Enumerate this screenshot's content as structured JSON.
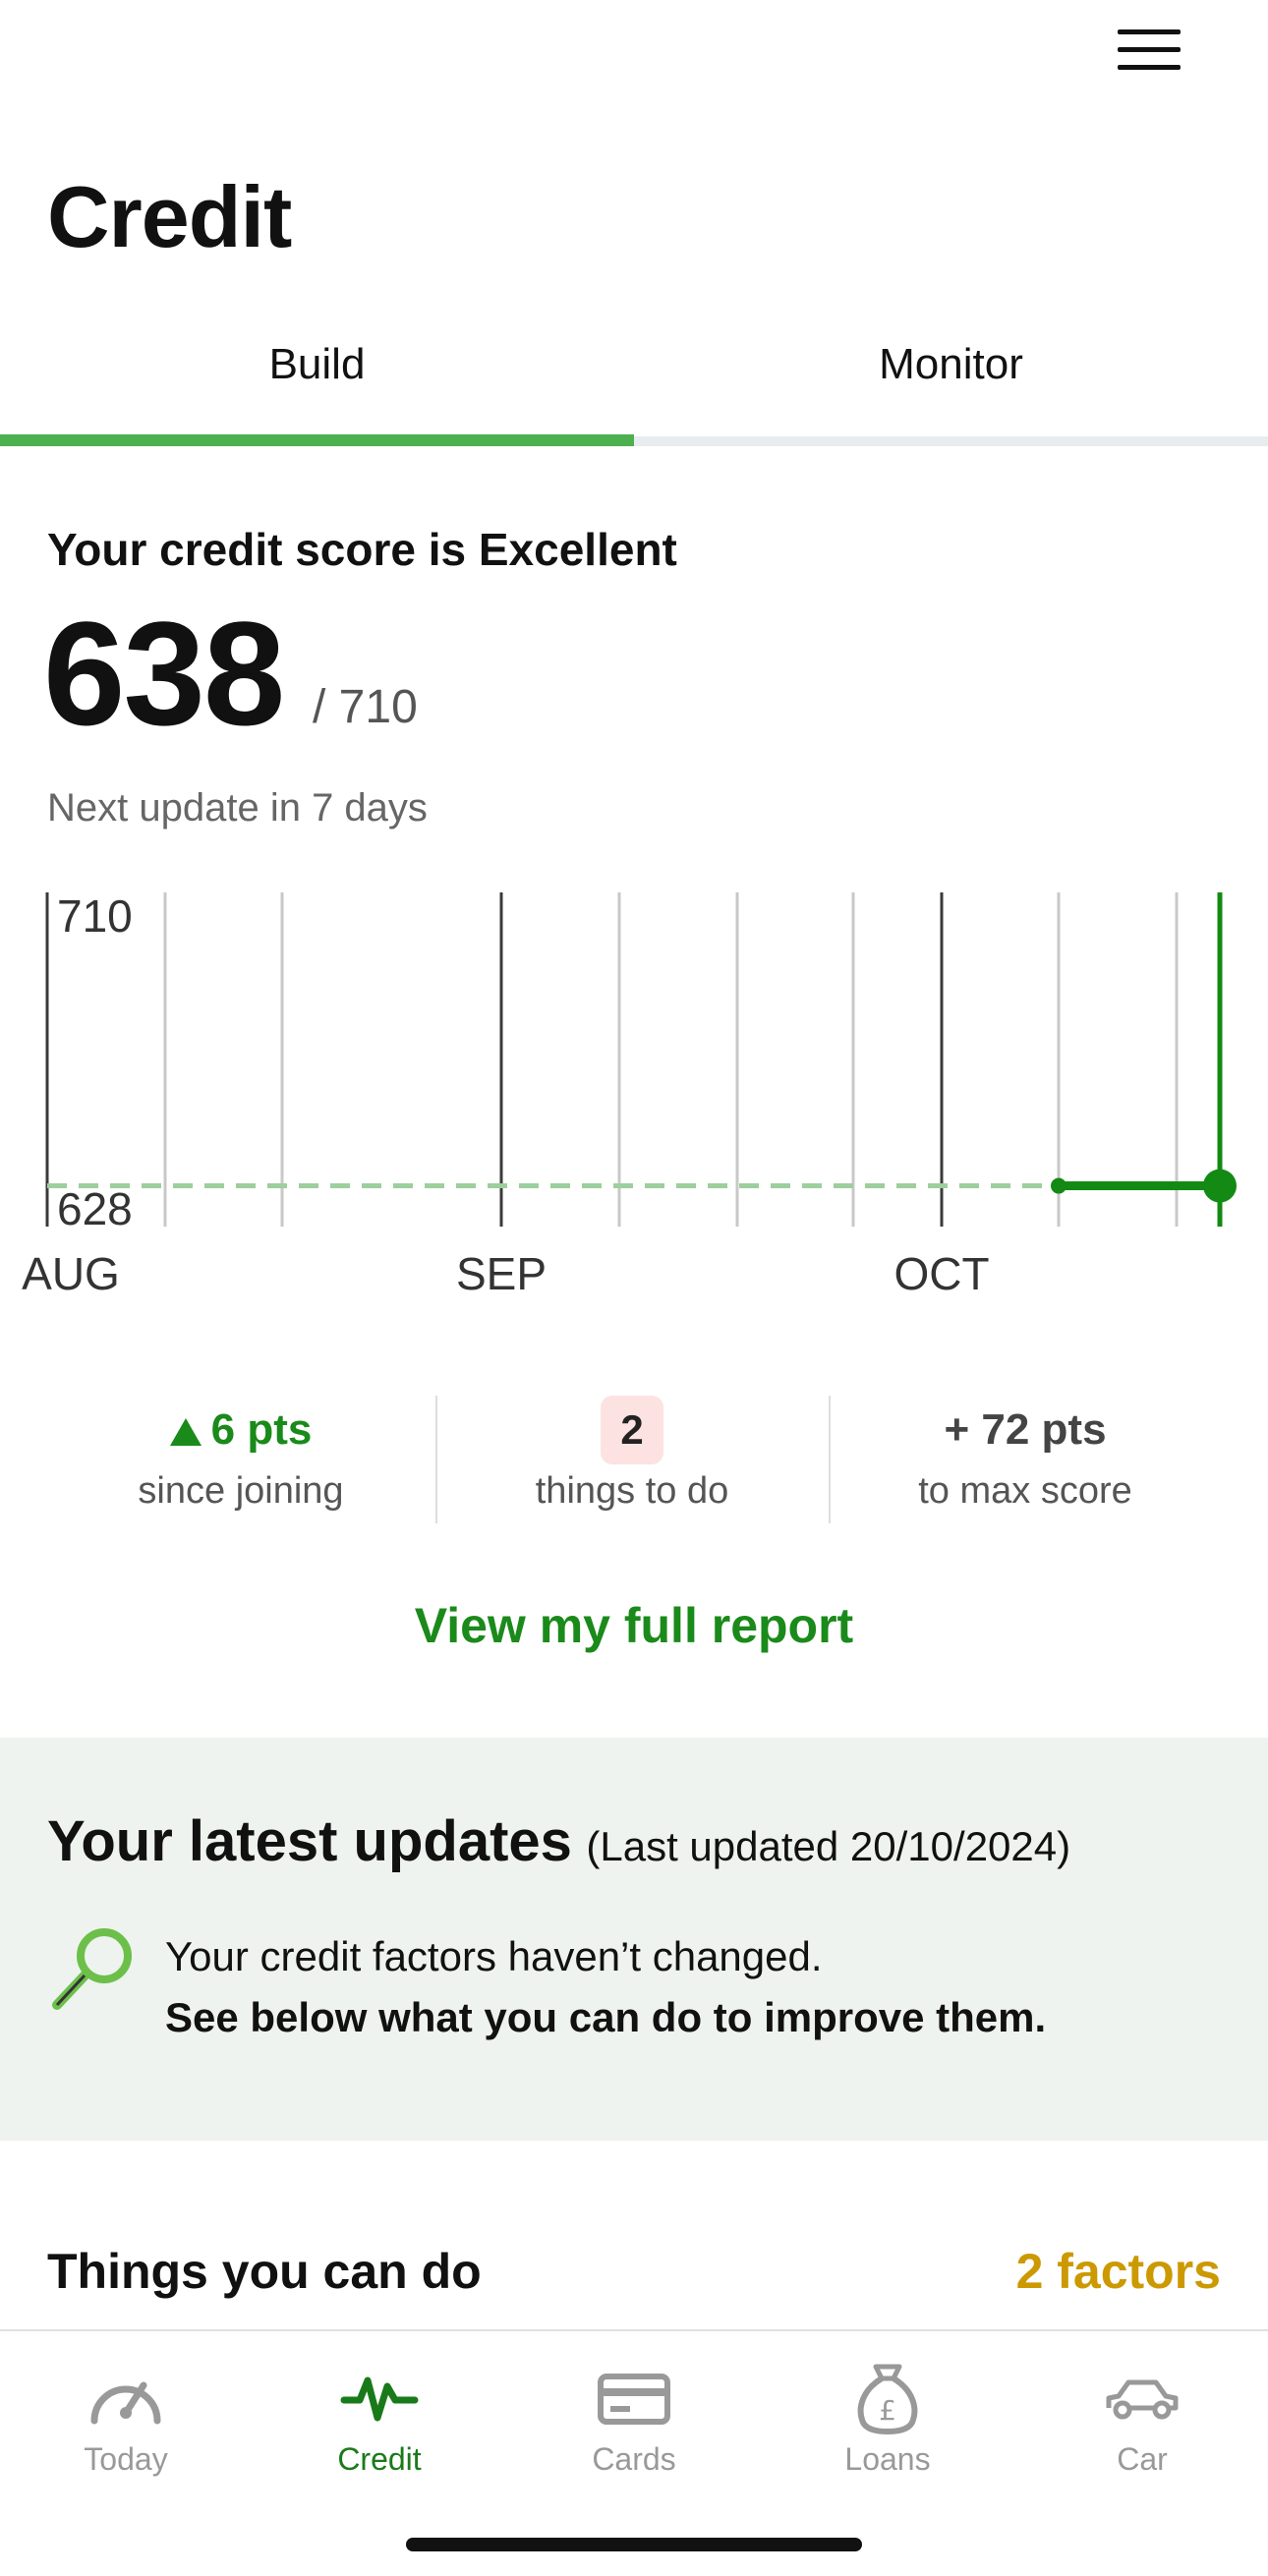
{
  "header": {
    "menu_icon": "hamburger-menu-icon"
  },
  "page_title": "Credit",
  "tabs": [
    {
      "label": "Build",
      "active": true
    },
    {
      "label": "Monitor",
      "active": false
    }
  ],
  "score": {
    "heading": "Your credit score is Excellent",
    "value": "638",
    "max": "/ 710",
    "next_update": "Next update in 7 days"
  },
  "chart_data": {
    "type": "line",
    "y_labels": [
      "710",
      "628"
    ],
    "ylim": [
      628,
      710
    ],
    "x_labels": [
      "AUG",
      "SEP",
      "OCT"
    ],
    "series": [
      {
        "values": [
          638,
          638
        ],
        "style": "solid",
        "color": "#138a13"
      }
    ],
    "baseline": {
      "value": 638,
      "style": "dashed",
      "color": "#9ccf9c"
    },
    "grid": true
  },
  "stats": [
    {
      "value": "6 pts",
      "label": "since joining",
      "icon": "up-triangle-icon"
    },
    {
      "value": "2",
      "label": "things to do"
    },
    {
      "value": "+ 72 pts",
      "label": "to max score"
    }
  ],
  "report_link": "View my full report",
  "updates": {
    "title": "Your latest updates",
    "date": "(Last updated 20/10/2024)",
    "line1": "Your credit factors haven’t changed.",
    "line2": "See below what you can do to improve them.",
    "icon": "magnifying-glass-icon"
  },
  "todo": {
    "title": "Things you can do",
    "count": "2 factors"
  },
  "bottom_nav": [
    {
      "label": "Today",
      "icon": "speedometer-icon"
    },
    {
      "label": "Credit",
      "icon": "pulse-icon",
      "active": true
    },
    {
      "label": "Cards",
      "icon": "card-icon"
    },
    {
      "label": "Loans",
      "icon": "money-bag-icon"
    },
    {
      "label": "Car",
      "icon": "car-icon"
    }
  ],
  "colors": {
    "accent": "#1a8a1a",
    "tab_underline": "#4caf50",
    "gold": "#cc9900",
    "panel_bg": "#eef3ef"
  }
}
